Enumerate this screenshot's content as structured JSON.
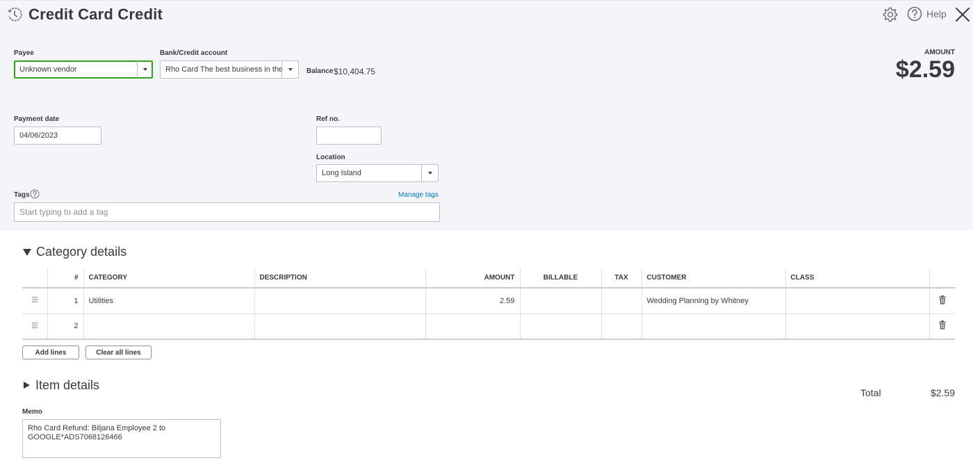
{
  "header": {
    "title": "Credit Card Credit",
    "help_label": "Help"
  },
  "payee": {
    "label": "Payee",
    "value": "Unknown vendor"
  },
  "account": {
    "label": "Bank/Credit account",
    "value": "Rho Card The best business in the"
  },
  "balance": {
    "label": "Balance",
    "value": "$10,404.75"
  },
  "amount": {
    "label": "AMOUNT",
    "value": "$2.59"
  },
  "payment_date": {
    "label": "Payment date",
    "value": "04/06/2023"
  },
  "ref_no": {
    "label": "Ref no.",
    "value": ""
  },
  "location": {
    "label": "Location",
    "value": "Long Island"
  },
  "tags": {
    "label": "Tags",
    "manage_link": "Manage tags",
    "placeholder": "Start typing to add a tag"
  },
  "category_details": {
    "heading": "Category details",
    "columns": [
      "#",
      "CATEGORY",
      "DESCRIPTION",
      "AMOUNT",
      "BILLABLE",
      "TAX",
      "CUSTOMER",
      "CLASS"
    ],
    "rows": [
      {
        "num": "1",
        "category": "Utilities",
        "description": "",
        "amount": "2.59",
        "billable": "",
        "tax": "",
        "customer": "Wedding Planning by Whitney",
        "class": ""
      },
      {
        "num": "2",
        "category": "",
        "description": "",
        "amount": "",
        "billable": "",
        "tax": "",
        "customer": "",
        "class": ""
      }
    ],
    "add_lines_label": "Add lines",
    "clear_lines_label": "Clear all lines"
  },
  "item_details": {
    "heading": "Item details"
  },
  "total": {
    "label": "Total",
    "value": "$2.59"
  },
  "memo": {
    "label": "Memo",
    "value": "Rho Card Refund: Biljana  Employee 2  to\nGOOGLE*ADS7068126466"
  },
  "icons": {
    "history": "history-icon",
    "settings": "gear-icon",
    "help": "help-circle-icon",
    "close": "close-icon",
    "drag": "drag-handle-icon",
    "delete": "trash-icon"
  },
  "colors": {
    "accent_green": "#2ca01c",
    "link_blue": "#0077c5",
    "header_bg": "#f4f5f8"
  }
}
